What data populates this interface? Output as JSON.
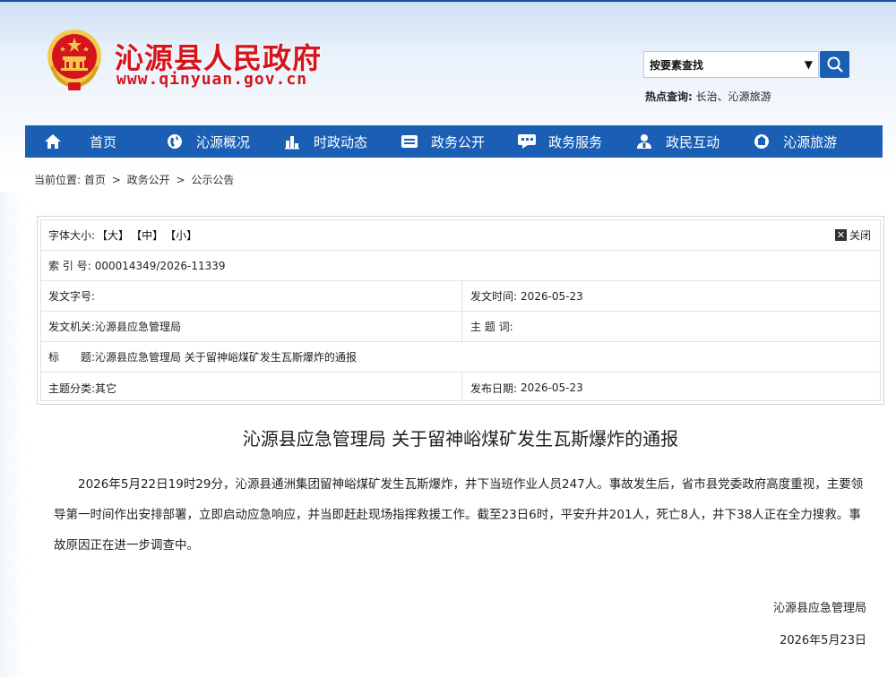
{
  "header": {
    "site_title": "沁源县人民政府",
    "site_url": "www.qinyuan.gov.cn",
    "search_select_value": "按要素查找",
    "hot_label": "热点查询:",
    "hot_items": "长治、沁源旅游"
  },
  "nav": {
    "items": [
      {
        "label": "首页",
        "icon": "home-icon"
      },
      {
        "label": "沁源概况",
        "icon": "globe-icon"
      },
      {
        "label": "时政动态",
        "icon": "bar-chart-icon"
      },
      {
        "label": "政务公开",
        "icon": "folder-icon"
      },
      {
        "label": "政务服务",
        "icon": "chat-icon"
      },
      {
        "label": "政民互动",
        "icon": "people-icon"
      },
      {
        "label": "沁源旅游",
        "icon": "travel-icon"
      }
    ]
  },
  "breadcrumb": {
    "prefix": "当前位置:",
    "items": [
      "首页",
      "政务公开",
      "公示公告"
    ],
    "sep": ">"
  },
  "meta": {
    "font_size_label": "字体大小:",
    "font_large": "【大】",
    "font_medium": "【中】",
    "font_small": "【小】",
    "close_label": "关闭",
    "index_label": "索 引 号:",
    "index_value": "000014349/2026-11339",
    "doc_no_label": "发文字号:",
    "doc_no_value": "",
    "issue_time_label": "发文时间:",
    "issue_time_value": "2026-05-23",
    "issuer_label": "发文机关:",
    "issuer_value": "沁源县应急管理局",
    "keyword_label": "主 题 词:",
    "keyword_value": "",
    "title_label": "标　　题:",
    "title_value": "沁源县应急管理局 关于留神峪煤矿发生瓦斯爆炸的通报",
    "category_label": "主题分类:",
    "category_value": "其它",
    "publish_label": "发布日期:",
    "publish_value": "2026-05-23"
  },
  "article": {
    "title": "沁源县应急管理局 关于留神峪煤矿发生瓦斯爆炸的通报",
    "body": "2026年5月22日19时29分，沁源县通洲集团留神峪煤矿发生瓦斯爆炸，井下当班作业人员247人。事故发生后，省市县党委政府高度重视，主要领导第一时间作出安排部署，立即启动应急响应，并当即赶赴现场指挥救援工作。截至23日6时，平安升井201人，死亡8人，井下38人正在全力搜救。事故原因正在进一步调查中。",
    "signer": "沁源县应急管理局",
    "date": "2026年5月23日"
  },
  "colors": {
    "brand_red": "#d4151b",
    "nav_blue": "#1b5fb5"
  }
}
